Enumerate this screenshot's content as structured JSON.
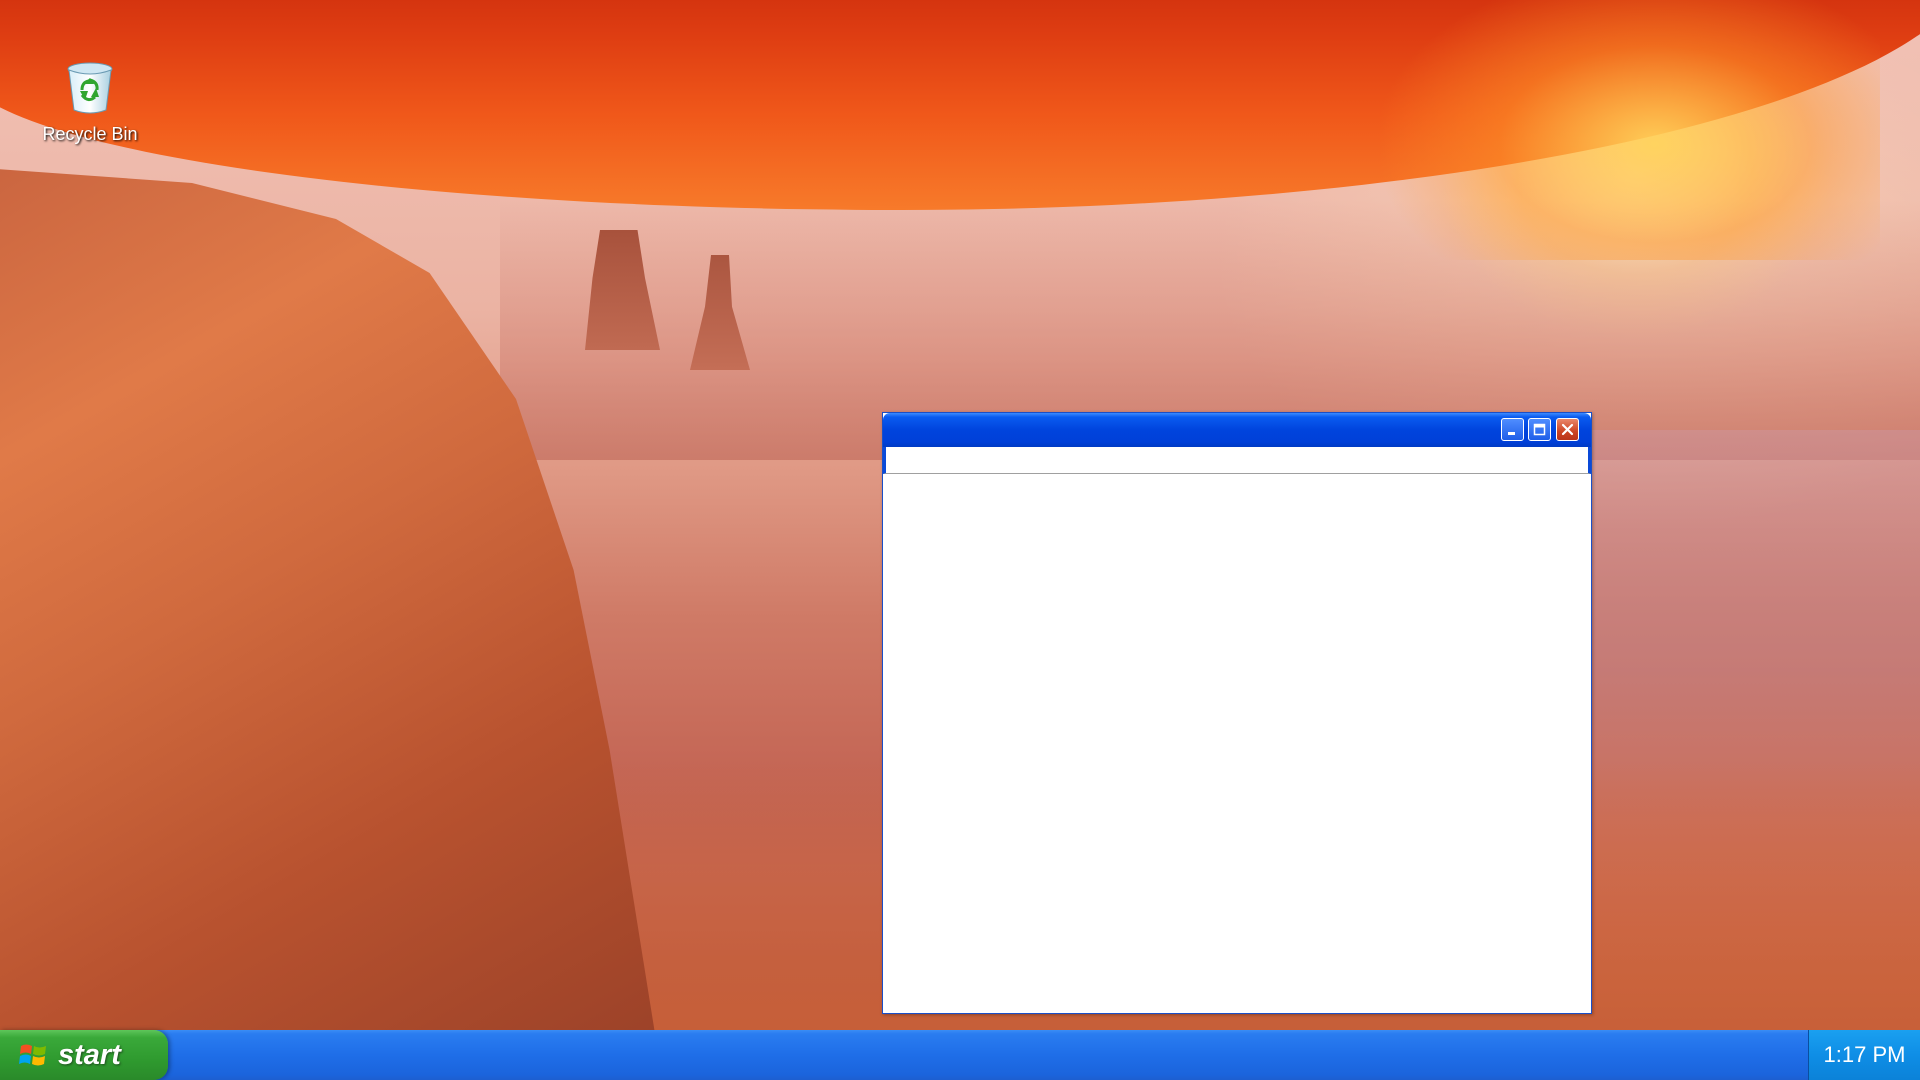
{
  "desktop": {
    "icons": [
      {
        "label": "Recycle Bin",
        "icon": "recycle-bin-icon"
      }
    ]
  },
  "window": {
    "title": "",
    "buttons": {
      "minimize": "minimize-icon",
      "maximize": "maximize-icon",
      "close": "close-icon"
    }
  },
  "taskbar": {
    "start_label": "start",
    "start_icon": "windows-logo-icon",
    "clock": "1:17 PM"
  },
  "colors": {
    "titlebar": "#0044dd",
    "taskbar": "#1f6ee8",
    "start_button": "#2f9a2f",
    "tray": "#0f8ee6",
    "close_button": "#cc4422"
  }
}
